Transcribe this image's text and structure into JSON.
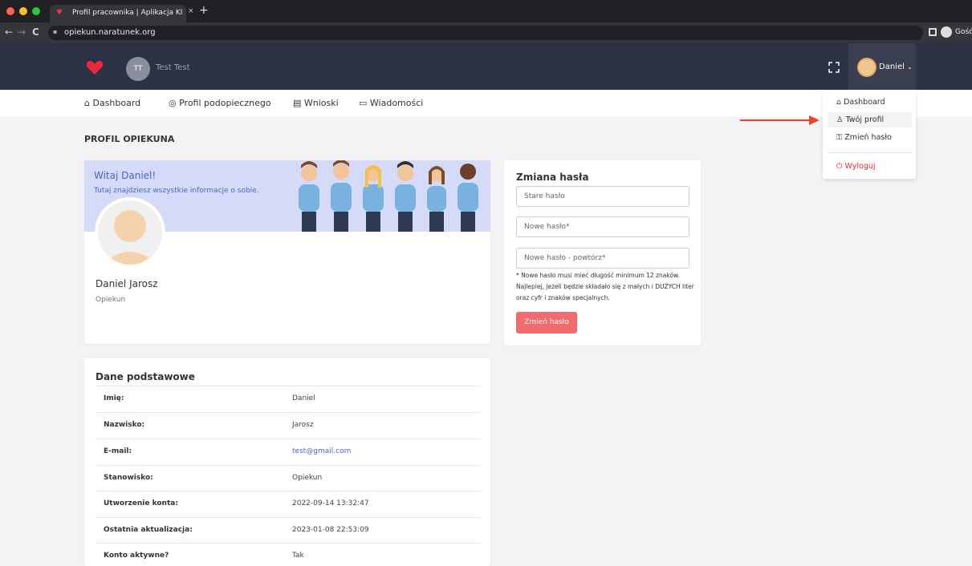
{
  "browser": {
    "tab_title": "Profil pracownika | Aplikacja KI",
    "tab_close": "×",
    "new_tab": "+",
    "url": "opiekun.naratunek.org",
    "guest_label": "Gość",
    "back_icon": "←",
    "forward_icon": "→",
    "reload_icon": "C",
    "lock_icon": "🔒",
    "window_controls": {
      "close": "#ff5f57",
      "min": "#febc2e",
      "max": "#28c840"
    }
  },
  "header": {
    "org_initials": "TT",
    "org_name": "Test Test",
    "user_name": "Daniel",
    "user_chevron": "⌄",
    "accent": "#e8283c"
  },
  "nav": {
    "items": [
      {
        "icon": "⌂",
        "label": "Dashboard"
      },
      {
        "icon": "◎",
        "label": "Profil podopiecznego"
      },
      {
        "icon": "▤",
        "label": "Wnioski"
      },
      {
        "icon": "▭",
        "label": "Wiadomości"
      }
    ]
  },
  "page": {
    "title": "PROFIL OPIEKUNA"
  },
  "profile": {
    "welcome": "Witaj Daniel!",
    "welcome_sub": "Tutaj znajdziesz wszystkie informacje o sobie.",
    "full_name": "Daniel Jarosz",
    "role": "Opiekun"
  },
  "password": {
    "title": "Zmiana hasła",
    "old_placeholder": "Stare hasło",
    "new_placeholder": "Nowe hasło*",
    "repeat_placeholder": "Nowe hasło - powtórz*",
    "note": "* Nowe hasło musi mieć długość minimum 12 znaków. Najlepiej, jeżeli będzie składało się z małych i DUŻYCH liter oraz cyfr i znaków specjalnych.",
    "button": "Zmień hasło"
  },
  "details": {
    "title": "Dane podstawowe",
    "rows": [
      {
        "label": "Imię:",
        "value": "Daniel"
      },
      {
        "label": "Nazwisko:",
        "value": "Jarosz"
      },
      {
        "label": "E-mail:",
        "value": "test@gmail.com"
      },
      {
        "label": "Stanowisko:",
        "value": "Opiekun"
      },
      {
        "label": "Utworzenie konta:",
        "value": "2022-09-14 13:32:47"
      },
      {
        "label": "Ostatnia aktualizacja:",
        "value": "2023-01-08 22:53:09"
      },
      {
        "label": "Konto aktywne?",
        "value": "Tak"
      }
    ]
  },
  "dropdown": {
    "items": [
      {
        "icon": "⌂",
        "label": "Dashboard"
      },
      {
        "icon": "♙",
        "label": "Twój profil"
      },
      {
        "icon": "⚿",
        "label": "Zmień hasło"
      },
      {
        "icon": "⏻",
        "label": "Wyloguj"
      }
    ]
  }
}
